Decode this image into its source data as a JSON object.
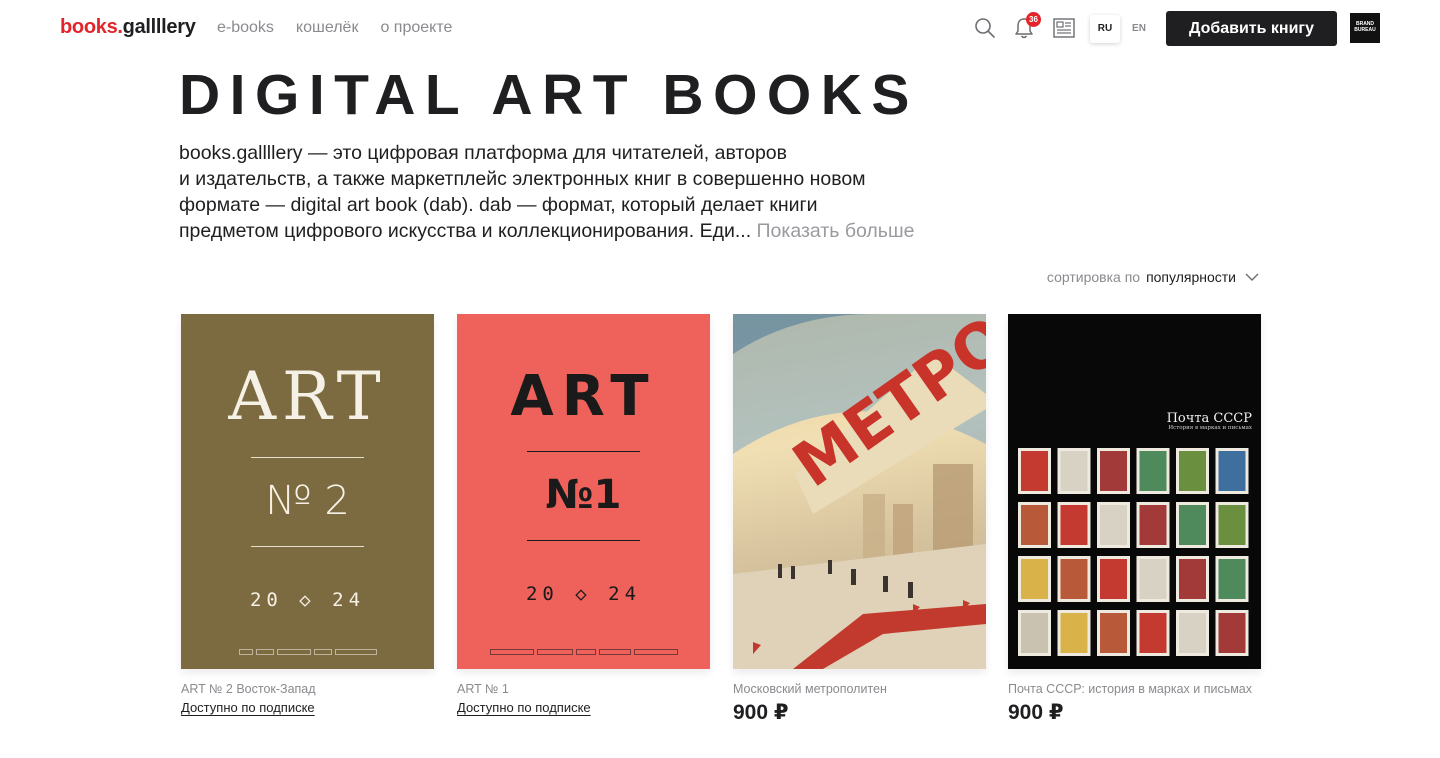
{
  "header": {
    "logo_part1": "books.",
    "logo_part2": "gallllery",
    "nav": [
      "e-books",
      "кошелёк",
      "о проекте"
    ],
    "notifications_count": "36",
    "lang_ru": "RU",
    "lang_en": "EN",
    "add_book_label": "Добавить книгу",
    "brand_line1": "BRAND",
    "brand_line2": "BUREAU"
  },
  "hero": {
    "title": "DIGITAL ART BOOKS",
    "description_lines": [
      "books.gallllery — это цифровая платформа для читателей, авторов",
      "и издательств, а также маркетплейс электронных книг в совершенно новом",
      "формате — digital art book (dab). dab — формат, который делает книги",
      "предметом цифрового искусства и коллекционирования. Еди..."
    ],
    "show_more": "Показать больше"
  },
  "sort": {
    "label": "сортировка по",
    "value": "популярности"
  },
  "books": [
    {
      "title": "ART № 2 Восток-Запад",
      "availability": "Доступно по подписке",
      "cover": {
        "word": "ART",
        "number": "№ 2",
        "year": "20 ◇ 24",
        "color": "#7c6b40"
      }
    },
    {
      "title": "ART № 1",
      "availability": "Доступно по подписке",
      "cover": {
        "word": "ART",
        "number": "№1",
        "year": "20 ◇ 24",
        "color": "#ee625b"
      }
    },
    {
      "title": "Московский метрополитен",
      "price": "900 ₽",
      "cover": {
        "word": "МЕТРО"
      }
    },
    {
      "title": "Почта СССР: история в марках и письмах",
      "price": "900 ₽",
      "cover": {
        "title": "Почта СССР",
        "subtitle": "История в марках и письмах"
      }
    }
  ],
  "colors": {
    "accent": "#e3252b",
    "text": "#1f1f22",
    "muted": "#8a8a8f"
  }
}
